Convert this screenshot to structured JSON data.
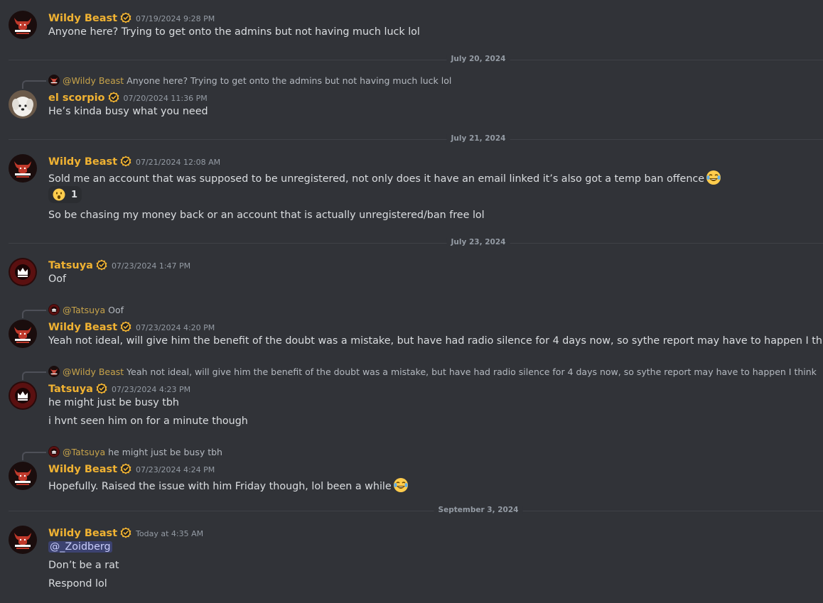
{
  "messages": {
    "m1": {
      "author": "Wildy Beast",
      "time": "07/19/2024 9:28 PM",
      "text": "Anyone here? Trying to get onto the admins but not having much luck lol"
    },
    "d1": "July 20, 2024",
    "m2": {
      "reply_author": "@Wildy Beast",
      "reply_text": "Anyone here? Trying to get onto the admins but not having much luck lol",
      "author": "el scorpio",
      "time": "07/20/2024 11:36 PM",
      "text": "He’s kinda busy what you need"
    },
    "d2": "July 21, 2024",
    "m3": {
      "author": "Wildy Beast",
      "time": "07/21/2024 12:08 AM",
      "text": "Sold me an account that was supposed to be unregistered, not only does it have an email linked it’s also got a temp ban offence",
      "reaction_count": "1",
      "text2": "So be chasing my money back or an account that is actually unregistered/ban free lol"
    },
    "d3": "July 23, 2024",
    "m4": {
      "author": "Tatsuya",
      "time": "07/23/2024 1:47 PM",
      "text": "Oof"
    },
    "m5": {
      "reply_author": "@Tatsuya",
      "reply_text": "Oof",
      "author": "Wildy Beast",
      "time": "07/23/2024 4:20 PM",
      "text": "Yeah not ideal, will give him the benefit of the doubt was a mistake, but have had radio silence for 4 days now, so sythe report may have to happen I think"
    },
    "m6": {
      "reply_author": "@Wildy Beast",
      "reply_text": "Yeah not ideal, will give him the benefit of the doubt was a mistake, but have had radio silence for 4 days now, so sythe report may have to happen I think",
      "author": "Tatsuya",
      "time": "07/23/2024 4:23 PM",
      "text": "he might just be busy tbh",
      "text2": "i hvnt seen him on for a minute though"
    },
    "m7": {
      "reply_author": "@Tatsuya",
      "reply_text": "he might just be busy tbh",
      "author": "Wildy Beast",
      "time": "07/23/2024 4:24 PM",
      "text": "Hopefully. Raised the issue with him Friday though, lol been a while"
    },
    "d4": "September 3, 2024",
    "m8": {
      "author": "Wildy Beast",
      "time": "Today at 4:35 AM",
      "mention": "@_Zoidberg",
      "text": "Don’t be a rat",
      "text2": "Respond lol"
    }
  },
  "colors": {
    "background": "#313338",
    "username": "#f0b232",
    "timestamp": "#949ba4",
    "mention_bg": "#3c4270"
  }
}
